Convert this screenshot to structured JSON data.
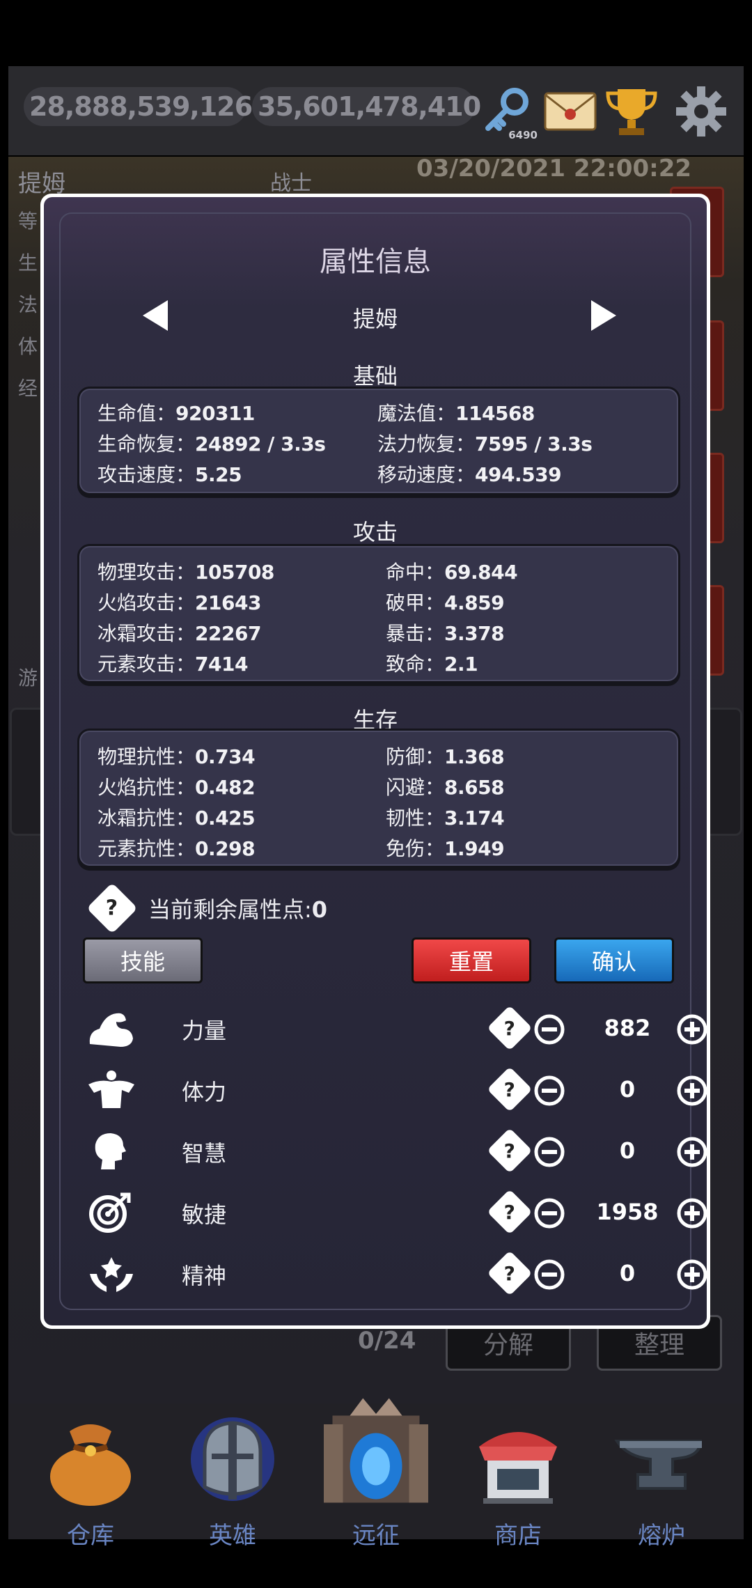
{
  "resources": {
    "gold": "28,888,539,126",
    "gems": "35,601,478,410",
    "keys": "6490"
  },
  "background": {
    "hero_name": "提姆",
    "hero_class": "战士",
    "datetime": "03/20/2021 22:00:22",
    "side_labels": [
      "等",
      "生",
      "法",
      "体",
      "经"
    ],
    "side_label_bottom": "游",
    "inventory_count": "0/24",
    "decompose_label": "分解",
    "sort_label": "整理"
  },
  "dialog": {
    "title": "属性信息",
    "hero_name": "提姆",
    "sections": {
      "basic": "基础",
      "attack": "攻击",
      "survival": "生存"
    },
    "basic": {
      "hp_label": "生命值：",
      "hp": "920311",
      "mp_label": "魔法值：",
      "mp": "114568",
      "hp_regen_label": "生命恢复：",
      "hp_regen": "24892 / 3.3s",
      "mp_regen_label": "法力恢复：",
      "mp_regen": "7595 / 3.3s",
      "atk_speed_label": "攻击速度：",
      "atk_speed": "5.25",
      "move_speed_label": "移动速度：",
      "move_speed": "494.539"
    },
    "attack": {
      "phys_label": "物理攻击：",
      "phys": "105708",
      "hit_label": "命中：",
      "hit": "69.844",
      "fire_label": "火焰攻击：",
      "fire": "21643",
      "pierce_label": "破甲：",
      "pierce": "4.859",
      "frost_label": "冰霜攻击：",
      "frost": "22267",
      "crit_label": "暴击：",
      "crit": "3.378",
      "elem_label": "元素攻击：",
      "elem": "7414",
      "fatal_label": "致命：",
      "fatal": "2.1"
    },
    "survival": {
      "phys_res_label": "物理抗性：",
      "phys_res": "0.734",
      "defense_label": "防御：",
      "defense": "1.368",
      "fire_res_label": "火焰抗性：",
      "fire_res": "0.482",
      "dodge_label": "闪避：",
      "dodge": "8.658",
      "frost_res_label": "冰霜抗性：",
      "frost_res": "0.425",
      "tenacity_label": "韧性：",
      "tenacity": "3.174",
      "elem_res_label": "元素抗性：",
      "elem_res": "0.298",
      "dmg_reduce_label": "免伤：",
      "dmg_reduce": "1.949"
    },
    "points_label": "当前剩余属性点:",
    "points_value": "0",
    "buttons": {
      "skill": "技能",
      "reset": "重置",
      "confirm": "确认"
    },
    "attributes": [
      {
        "name": "力量",
        "value": "882",
        "icon": "strength-arm-icon"
      },
      {
        "name": "体力",
        "value": "0",
        "icon": "stamina-torso-icon"
      },
      {
        "name": "智慧",
        "value": "0",
        "icon": "wisdom-head-icon"
      },
      {
        "name": "敏捷",
        "value": "1958",
        "icon": "agility-target-icon"
      },
      {
        "name": "精神",
        "value": "0",
        "icon": "spirit-hands-icon"
      }
    ]
  },
  "nav": {
    "warehouse": "仓库",
    "hero": "英雄",
    "expedition": "远征",
    "shop": "商店",
    "forge": "熔炉"
  },
  "colors": {
    "dialog_bg": "#2e2c40",
    "reset_red": "#d92a2a",
    "confirm_blue": "#1f86d6",
    "nav_label_blue": "#6a86c4"
  }
}
